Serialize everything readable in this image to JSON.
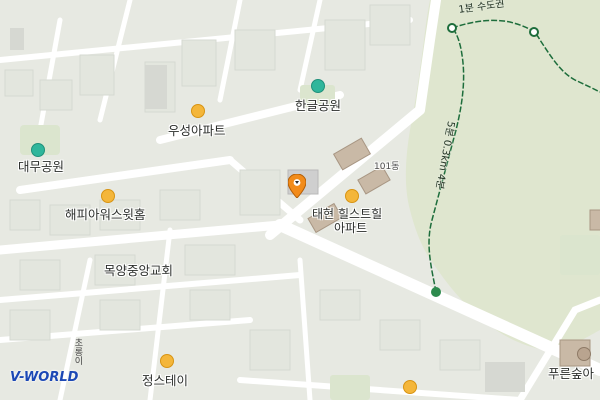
{
  "map": {
    "brand": "V-WORLD",
    "colors": {
      "background": "#eceee8",
      "block": "#e0e3dc",
      "road": "#ffffff",
      "park": "#dfe8d2",
      "trail": "#1d6d3b",
      "marker": "#f28b1a"
    },
    "labels": {
      "daemu_park": "대무공원",
      "hangeul_park": "한글공원",
      "woosung_apt": "우성아파트",
      "happy_apt": "해피아워스윗홈",
      "mokyang_church": "목양중앙교회",
      "jeongstay": "정스테이",
      "taehyeon_a": "태현",
      "taehyeon_b": "힐스트힐",
      "taehyeon_c": "아파트",
      "building_101": "101동",
      "forest_apt": "푸른숲아",
      "road_vertical": "초롱이",
      "trail_dist": "5분 0.3km 4분",
      "trail_top": "1분 수도권"
    },
    "icons": {
      "apartment": "apartment-icon",
      "park": "park-icon",
      "marker": "location-pin-icon",
      "trail_node": "trail-node-icon"
    }
  }
}
